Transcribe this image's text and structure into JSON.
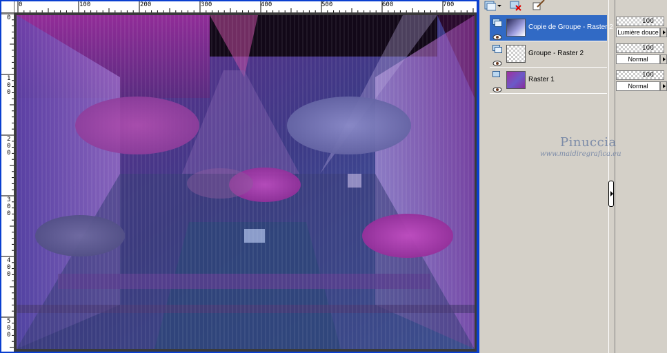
{
  "rulers": {
    "horizontal": [
      "0",
      "100",
      "200",
      "300",
      "400",
      "500",
      "600",
      "700"
    ],
    "vertical": [
      "0",
      "100",
      "200",
      "300",
      "400",
      "500"
    ]
  },
  "toolbar": {
    "icons": [
      "new-layer-icon",
      "dropdown-arrow-icon",
      "delete-layer-icon",
      "brush-icon"
    ]
  },
  "layers": [
    {
      "name": "Copie de Groupe - Raster 2",
      "opacity": "100",
      "mode": "Lumière douce",
      "selected": true
    },
    {
      "name": "Groupe - Raster 2",
      "opacity": "100",
      "mode": "Normal",
      "selected": false
    },
    {
      "name": "Raster 1",
      "opacity": "100",
      "mode": "Normal",
      "selected": false
    }
  ],
  "watermark": {
    "name": "Pinuccia",
    "url": "www.maidiregrafica.eu"
  },
  "colors": {
    "window_frame": "#0a3fd0",
    "selection": "#316ac5",
    "panel_bg": "#d4d0c8",
    "image_purple": "#8a2a9c",
    "image_blue": "#4a6fb8"
  }
}
